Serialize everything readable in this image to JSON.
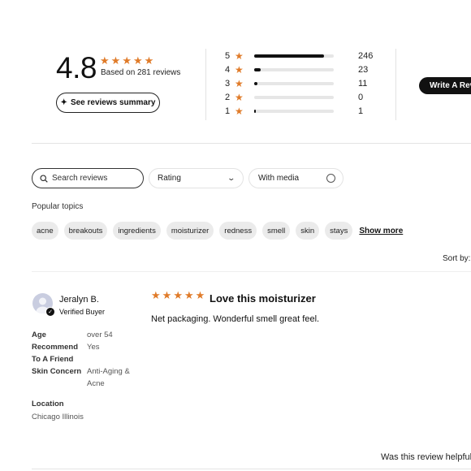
{
  "summary": {
    "average": "4.8",
    "based_on": "Based on 281 reviews",
    "summary_button": "See reviews summary",
    "star_color": "#e07b29"
  },
  "histogram": [
    {
      "stars": "5",
      "count": "246",
      "fraction": 0.88
    },
    {
      "stars": "4",
      "count": "23",
      "fraction": 0.08
    },
    {
      "stars": "3",
      "count": "11",
      "fraction": 0.04
    },
    {
      "stars": "2",
      "count": "0",
      "fraction": 0
    },
    {
      "stars": "1",
      "count": "1",
      "fraction": 0.01
    }
  ],
  "write_review": "Write A Review",
  "filters": {
    "search_placeholder": "Search reviews",
    "rating_label": "Rating",
    "with_media_label": "With media"
  },
  "popular_topics": {
    "label": "Popular topics",
    "topics": [
      "acne",
      "breakouts",
      "ingredients",
      "moisturizer",
      "redness",
      "smell",
      "skin",
      "stays"
    ],
    "show_more": "Show more"
  },
  "sort_by_label": "Sort by:",
  "review": {
    "reviewer": "Jeralyn B.",
    "verified_label": "Verified Buyer",
    "rating": 5,
    "title": "Love this moisturizer",
    "body": "Net packaging. Wonderful smell great feel.",
    "attributes": [
      {
        "label": "Age",
        "value": "over 54"
      },
      {
        "label": "Recommend",
        "value": "Yes"
      },
      {
        "label": "To A Friend",
        "value": ""
      },
      {
        "label": "Skin Concern",
        "value": "Anti-Aging & Acne"
      }
    ],
    "location_label": "Location",
    "location": "Chicago Illinois",
    "helpful_label": "Was this review helpful?"
  }
}
